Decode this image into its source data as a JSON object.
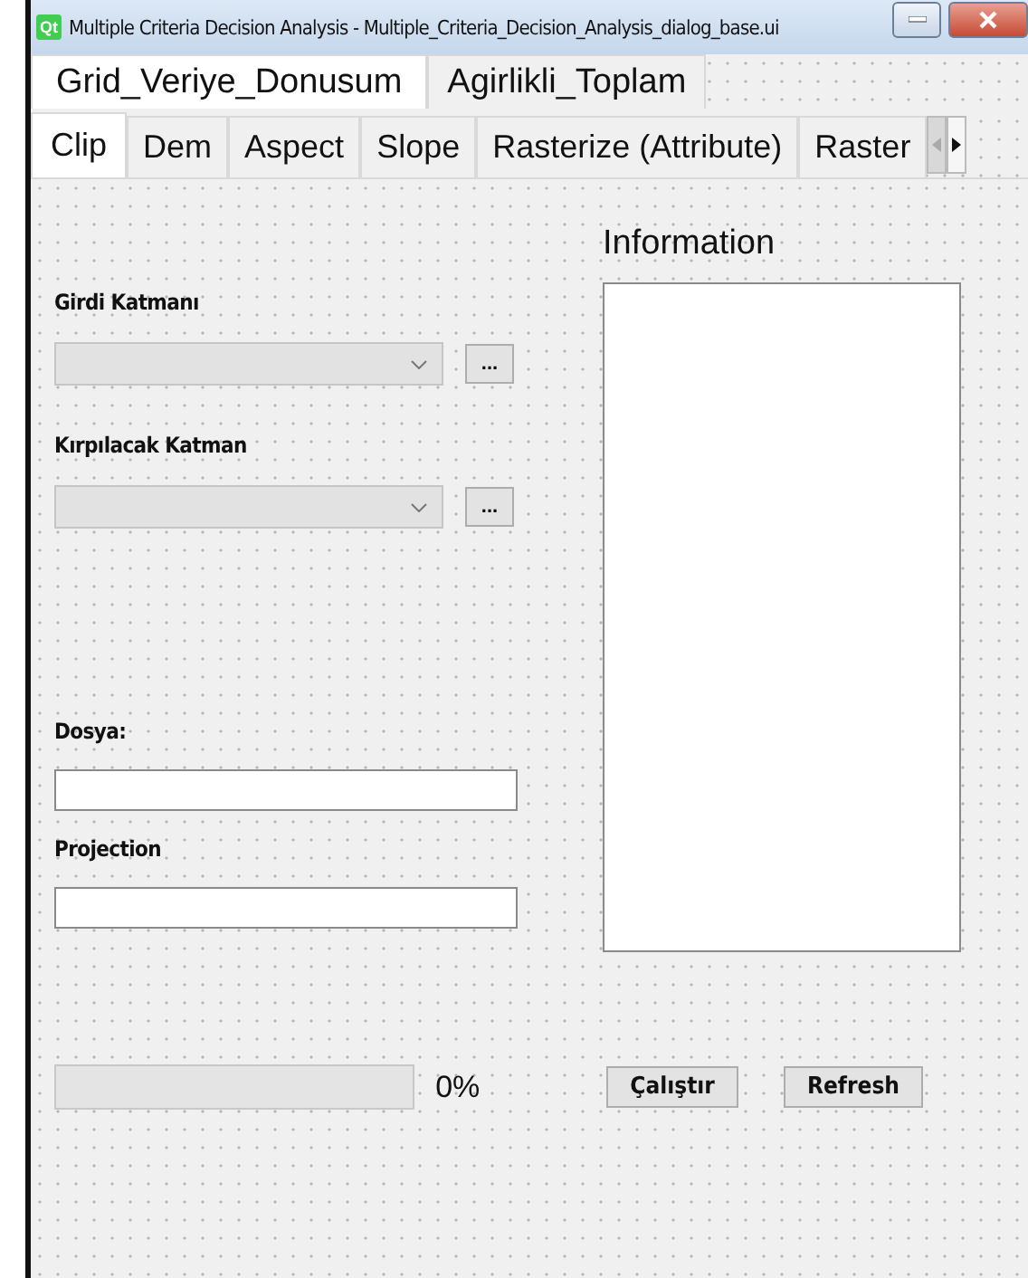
{
  "window": {
    "title": "Multiple Criteria Decision Analysis - Multiple_Criteria_Decision_Analysis_dialog_base.ui",
    "app_icon": "Qt"
  },
  "top_tabs": [
    {
      "label": "Grid_Veriye_Donusum",
      "selected": true
    },
    {
      "label": "Agirlikli_Toplam",
      "selected": false
    }
  ],
  "tabs": [
    {
      "label": "Clip",
      "selected": true
    },
    {
      "label": "Dem",
      "selected": false
    },
    {
      "label": "Aspect",
      "selected": false
    },
    {
      "label": "Slope",
      "selected": false
    },
    {
      "label": "Rasterize (Attribute)",
      "selected": false
    },
    {
      "label": "Raster",
      "selected": false
    }
  ],
  "form": {
    "input_layer": {
      "label": "Girdi Katmanı",
      "browse": "..."
    },
    "clip_layer": {
      "label": "Kırpılacak Katman",
      "browse": "..."
    },
    "file": {
      "label": "Dosya:"
    },
    "projection": {
      "label": "Projection"
    }
  },
  "information": {
    "label": "Information"
  },
  "progress": {
    "level": 0,
    "reading": "0%"
  },
  "buttons": [
    "Çalıştır",
    "Refresh"
  ]
}
